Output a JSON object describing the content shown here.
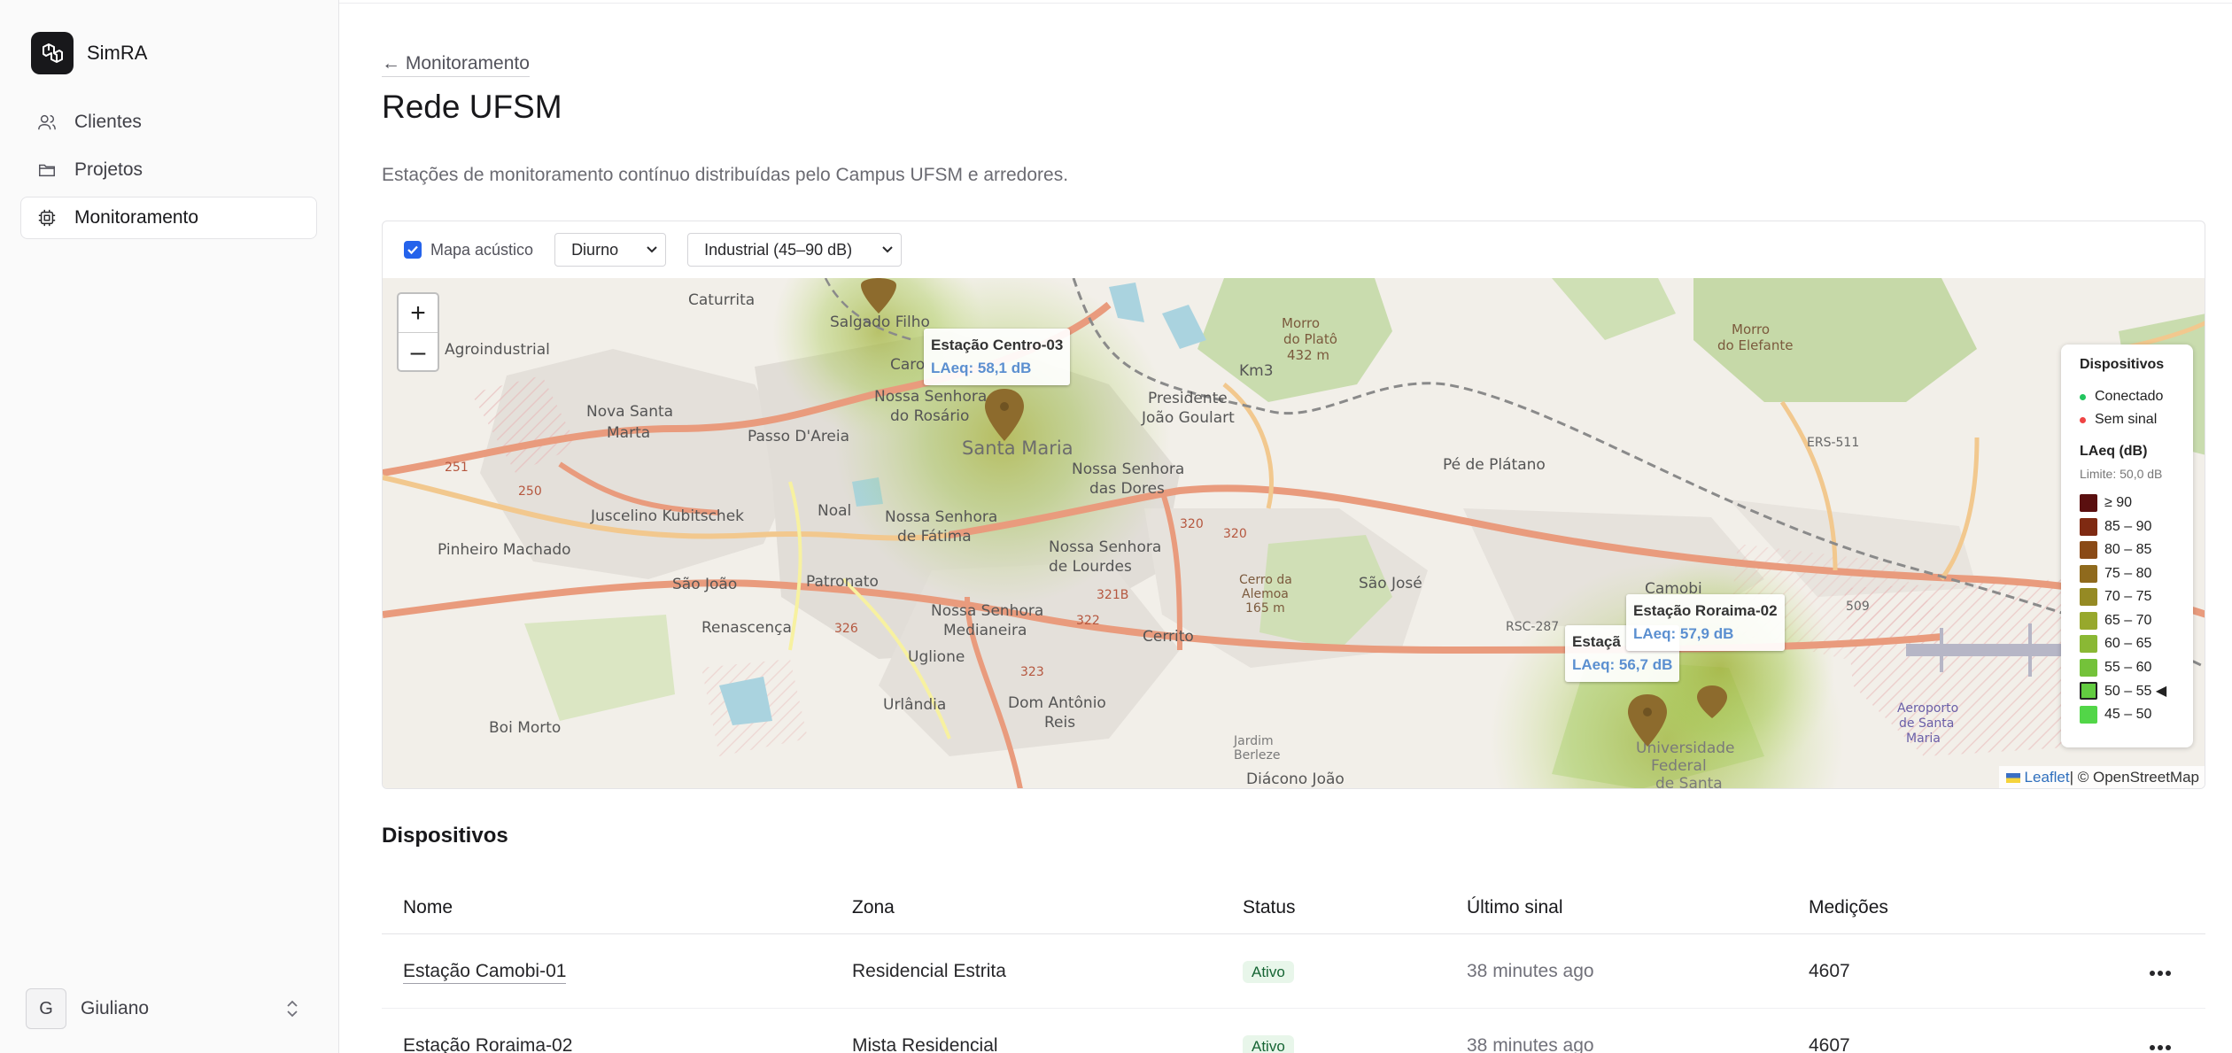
{
  "sidebar": {
    "brand": "SimRA",
    "items": [
      {
        "label": "Clientes",
        "icon": "users-icon"
      },
      {
        "label": "Projetos",
        "icon": "folder-icon"
      },
      {
        "label": "Monitoramento",
        "icon": "chip-icon",
        "active": true
      }
    ],
    "user": {
      "initial": "G",
      "name": "Giuliano"
    }
  },
  "header": {
    "back_label": "← Monitoramento",
    "title": "Rede UFSM",
    "description": "Estações de monitoramento contínuo distribuídas pelo Campus UFSM e arredores."
  },
  "map_controls": {
    "acoustic_map_label": "Mapa acústico",
    "acoustic_map_checked": true,
    "period_value": "Diurno",
    "zone_value": "Industrial (45–90 dB)"
  },
  "map": {
    "zoom_in": "+",
    "zoom_out": "–",
    "tooltips": [
      {
        "name": "Estação Centro-03",
        "value": "LAeq: 58,1 dB"
      },
      {
        "name": "Estação Roraima-02",
        "value": "LAeq: 57,9 dB"
      },
      {
        "name": "Estaçã",
        "value": "LAeq: 56,7 dB"
      }
    ],
    "place_labels": [
      "Caturrita",
      "Agroindustrial",
      "Nova Santa",
      "Marta",
      "Salgado Filho",
      "Caro",
      "Passo D'Areia",
      "Nossa Senhora",
      "do Rosário",
      "Santa Maria",
      "Presidente",
      "João Goulart",
      "Km3",
      "Morro",
      "do Platô",
      "432 m",
      "Morro",
      "do Elefante",
      "Pé de Plátano",
      "ERS-511",
      "Juscelino Kubitschek",
      "Noal",
      "Nossa Senhora",
      "das Dores",
      "Nossa Senhora",
      "de Fátima",
      "Pinheiro Machado",
      "São João",
      "Patronato",
      "Nossa Senhora",
      "de Lourdes",
      "Cerro da",
      "Alemoa",
      "165 m",
      "São José",
      "Camobi",
      "Renascença",
      "Nossa Senhora",
      "Medianeira",
      "Cerrito",
      "RSC-287",
      "Uglione",
      "Urlândia",
      "Dom Antônio",
      "Reis",
      "Boi Morto",
      "Jardim",
      "Berleze",
      "Diácono João",
      "Universidade",
      "Federal",
      "de Santa",
      "Aeroporto",
      "de Santa",
      "Maria",
      "251",
      "250",
      "326",
      "322",
      "321B",
      "323",
      "320",
      "320",
      "509"
    ],
    "legend": {
      "devices_title": "Dispositivos",
      "connected_label": "Conectado",
      "connected_color": "#22c55e",
      "disconnected_label": "Sem sinal",
      "disconnected_color": "#ef4444",
      "laeq_title": "LAeq (dB)",
      "limit_label": "Limite: 50,0 dB",
      "scale": [
        {
          "label": "≥ 90",
          "color": "#5a0f0f"
        },
        {
          "label": "85 – 90",
          "color": "#7f2a12"
        },
        {
          "label": "80 – 85",
          "color": "#8a4a16"
        },
        {
          "label": "75 – 80",
          "color": "#8f6a1d"
        },
        {
          "label": "70 – 75",
          "color": "#958a24"
        },
        {
          "label": "65 – 70",
          "color": "#97a82c"
        },
        {
          "label": "60 – 65",
          "color": "#8ab834"
        },
        {
          "label": "55 – 60",
          "color": "#74c23a"
        },
        {
          "label": "50 – 55 ◀",
          "color": "#62cc40",
          "selected": true
        },
        {
          "label": "45 – 50",
          "color": "#52d648"
        }
      ]
    },
    "attribution_leaflet": "Leaflet",
    "attribution_rest": " | © OpenStreetMap"
  },
  "devices": {
    "title": "Dispositivos",
    "columns": [
      "Nome",
      "Zona",
      "Status",
      "Último sinal",
      "Medições"
    ],
    "rows": [
      {
        "name": "Estação Camobi-01",
        "zone": "Residencial Estrita",
        "status": "Ativo",
        "last_signal": "38 minutes ago",
        "measurements": "4607"
      },
      {
        "name": "Estação Roraima-02",
        "zone": "Mista Residencial",
        "status": "Ativo",
        "last_signal": "38 minutes ago",
        "measurements": "4607"
      }
    ]
  }
}
